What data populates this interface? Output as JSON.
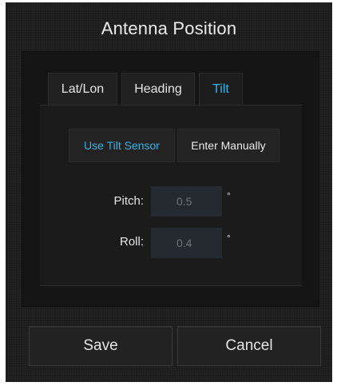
{
  "dialog": {
    "title": "Antenna Position"
  },
  "tabs": [
    {
      "label": "Lat/Lon",
      "active": false
    },
    {
      "label": "Heading",
      "active": false
    },
    {
      "label": "Tilt",
      "active": true
    }
  ],
  "tilt": {
    "modes": [
      {
        "label": "Use Tilt Sensor",
        "selected": true
      },
      {
        "label": "Enter Manually",
        "selected": false
      }
    ],
    "fields": [
      {
        "label": "Pitch:",
        "value": "0.5",
        "unit": "°"
      },
      {
        "label": "Roll:",
        "value": "0.4",
        "unit": "°"
      }
    ]
  },
  "footer": {
    "save_label": "Save",
    "cancel_label": "Cancel"
  },
  "colors": {
    "accent": "#39b3e6",
    "background": "#1c1c1c",
    "input_bg": "#252a30"
  }
}
